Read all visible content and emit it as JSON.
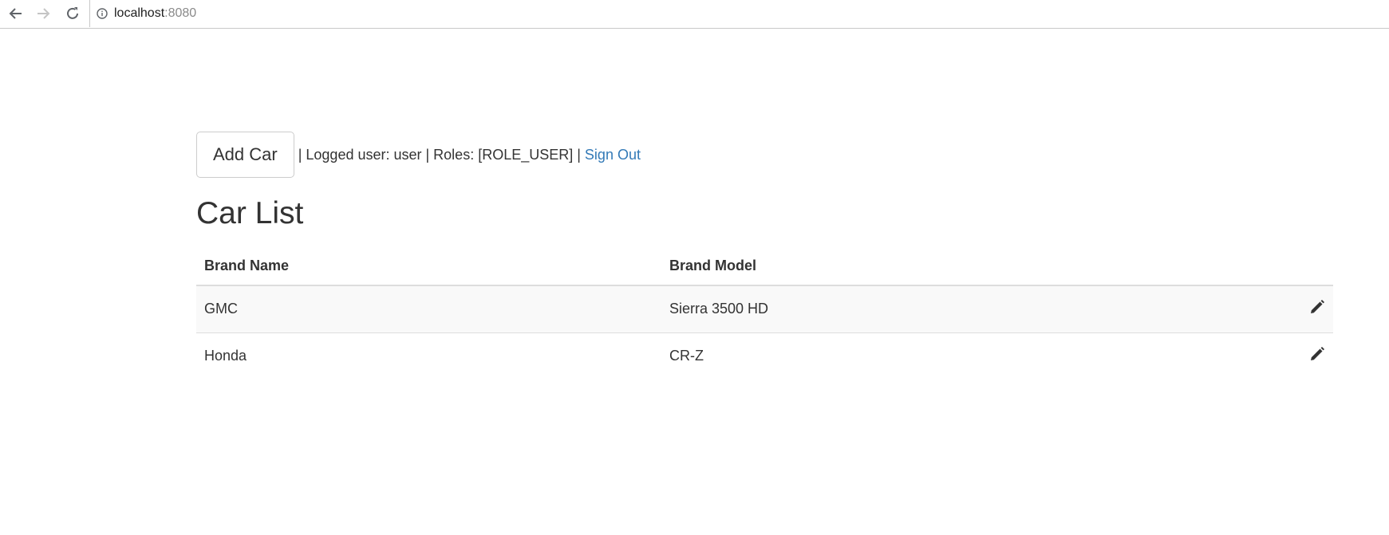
{
  "browser": {
    "url_host": "localhost",
    "url_port": ":8080",
    "icons": {
      "back": "arrow-left-icon",
      "forward": "arrow-right-icon",
      "reload": "reload-icon",
      "info": "info-icon"
    }
  },
  "toolbar": {
    "add_car_label": "Add Car",
    "user_info_text": "| Logged user: user | Roles: [ROLE_USER] |",
    "sign_out_label": "Sign Out"
  },
  "page": {
    "title": "Car List"
  },
  "table": {
    "headers": {
      "brand_name": "Brand Name",
      "brand_model": "Brand Model"
    },
    "rows": [
      {
        "brand_name": "GMC",
        "brand_model": "Sierra 3500 HD",
        "action_icon": "pencil-icon"
      },
      {
        "brand_name": "Honda",
        "brand_model": "CR-Z",
        "action_icon": "pencil-icon"
      }
    ]
  },
  "colors": {
    "link": "#337ab7",
    "text": "#333333",
    "stripe": "#f9f9f9",
    "border": "#dddddd"
  }
}
